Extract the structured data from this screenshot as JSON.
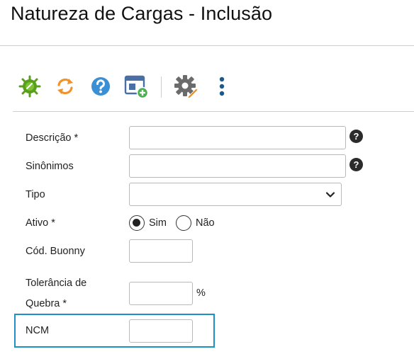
{
  "page": {
    "title": "Natureza de Cargas - Inclusão"
  },
  "toolbar": {
    "icons": [
      {
        "name": "bug-icon",
        "color": "#5a9e1e"
      },
      {
        "name": "refresh-icon",
        "color": "#f0932b"
      },
      {
        "name": "help-circle-icon",
        "color": "#3b8fd4"
      },
      {
        "name": "add-window-icon",
        "color": "#4a6fa5"
      },
      {
        "name": "gear-edit-icon",
        "color": "#6b6b6b"
      },
      {
        "name": "more-vertical-icon",
        "color": "#1d5a8a"
      }
    ]
  },
  "form": {
    "descricao": {
      "label": "Descrição *",
      "value": "",
      "help": "?"
    },
    "sinonimos": {
      "label": "Sinônimos",
      "value": "",
      "help": "?"
    },
    "tipo": {
      "label": "Tipo",
      "selected": ""
    },
    "ativo": {
      "label": "Ativo *",
      "options": [
        "Sim",
        "Não"
      ],
      "selected": "Sim"
    },
    "cod_buonny": {
      "label": "Cód. Buonny",
      "value": ""
    },
    "tolerancia": {
      "label_line1": "Tolerância de",
      "label_line2": "Quebra *",
      "value": "",
      "unit": "%"
    },
    "ncm": {
      "label": "NCM",
      "value": ""
    }
  },
  "colors": {
    "focus_border": "#1e90c8"
  }
}
